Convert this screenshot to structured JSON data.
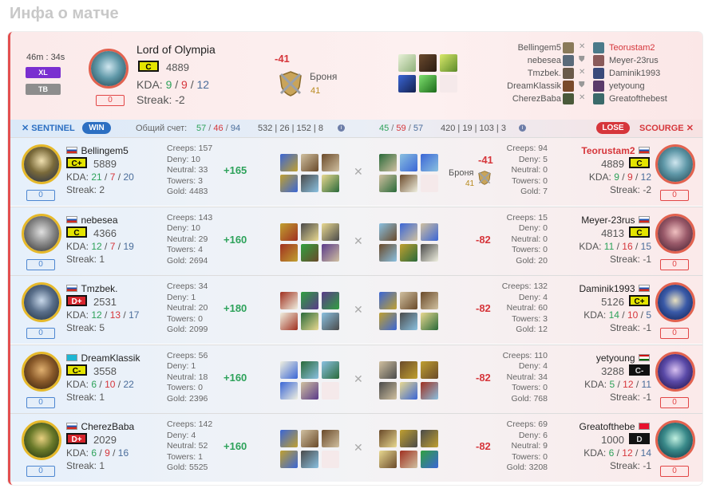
{
  "page_title": "Инфа о матче",
  "header": {
    "duration": "46m : 34s",
    "tag_xl": "XL",
    "tag_tb": "TB",
    "player_name": "Lord of Olympia",
    "rank": "C",
    "mmr": "4889",
    "kda_label": "KDA:",
    "kda_k": "9",
    "kda_d": "9",
    "kda_a": "12",
    "streak": "Streak: -2",
    "badge": "0",
    "delta": "-41",
    "armor_label": "Броня",
    "armor_value": "41",
    "matchups": [
      {
        "left": "Bellingem5",
        "right": "Teorustam2",
        "right_highlight": true
      },
      {
        "left": "nebesea",
        "right": "Meyer-23rus"
      },
      {
        "left": "Tmzbek.",
        "right": "Daminik1993"
      },
      {
        "left": "DreamKlassik",
        "right": "yetyoung"
      },
      {
        "left": "CherezBaba",
        "right": "Greatofthebest"
      }
    ]
  },
  "score": {
    "sentinel": "SENTINEL",
    "win": "WIN",
    "total_label": "Общий счет:",
    "s_k": "57",
    "s_d": "46",
    "s_a": "94",
    "s_stats": "532 | 26 | 152 | 8",
    "sc_k": "45",
    "sc_d": "59",
    "sc_a": "57",
    "sc_stats": "420 | 19 | 103 | 3",
    "lose": "LOSE",
    "scourge": "SCOURGE"
  },
  "rows": [
    {
      "l": {
        "name": "Bellingem5",
        "flag": "ru",
        "rank": "C+",
        "rank_style": "yellow",
        "mmr": "5889",
        "k": "21",
        "d": "7",
        "a": "20",
        "streak": "Streak: 2",
        "badge": "0",
        "creeps": "Creeps: 157",
        "deny": "Deny: 10",
        "neutral": "Neutral: 33",
        "towers": "Towers: 3",
        "gold": "Gold: 4483",
        "delta": "+165"
      },
      "r": {
        "name": "Teorustam2",
        "flag": "ru",
        "rank": "C",
        "rank_style": "yellow",
        "mmr": "4889",
        "k": "9",
        "d": "9",
        "a": "12",
        "streak": "Streak: -2",
        "badge": "0",
        "creeps": "Creeps: 94",
        "deny": "Deny: 5",
        "neutral": "Neutral: 0",
        "towers": "Towers: 0",
        "gold": "Gold: 7",
        "delta": "-41",
        "armor_label": "Броня",
        "armor_value": "41"
      }
    },
    {
      "l": {
        "name": "nebesea",
        "flag": "ru",
        "rank": "C",
        "rank_style": "yellow",
        "mmr": "4366",
        "k": "12",
        "d": "7",
        "a": "19",
        "streak": "Streak: 1",
        "badge": "0",
        "creeps": "Creeps: 143",
        "deny": "Deny: 10",
        "neutral": "Neutral: 29",
        "towers": "Towers: 4",
        "gold": "Gold: 2694",
        "delta": "+160"
      },
      "r": {
        "name": "Meyer-23rus",
        "flag": "ru",
        "rank": "C",
        "rank_style": "yellow",
        "mmr": "4813",
        "k": "11",
        "d": "16",
        "a": "15",
        "streak": "Streak: -1",
        "badge": "0",
        "creeps": "Creeps: 15",
        "deny": "Deny: 0",
        "neutral": "Neutral: 0",
        "towers": "Towers: 0",
        "gold": "Gold: 20",
        "delta": "-82"
      }
    },
    {
      "l": {
        "name": "Tmzbek.",
        "flag": "ru",
        "rank": "D+",
        "rank_style": "red",
        "mmr": "2531",
        "k": "12",
        "d": "13",
        "a": "17",
        "streak": "Streak: 5",
        "badge": "0",
        "creeps": "Creeps: 34",
        "deny": "Deny: 1",
        "neutral": "Neutral: 20",
        "towers": "Towers: 0",
        "gold": "Gold: 2099",
        "delta": "+180"
      },
      "r": {
        "name": "Daminik1993",
        "flag": "ru",
        "rank": "C+",
        "rank_style": "yellow",
        "mmr": "5126",
        "k": "14",
        "d": "10",
        "a": "5",
        "streak": "Streak: -1",
        "badge": "0",
        "creeps": "Creeps: 132",
        "deny": "Deny: 4",
        "neutral": "Neutral: 60",
        "towers": "Towers: 3",
        "gold": "Gold: 12",
        "delta": "-82"
      }
    },
    {
      "l": {
        "name": "DreamKlassik",
        "flag": "kz",
        "rank": "C-",
        "rank_style": "yellow",
        "mmr": "3558",
        "k": "6",
        "d": "10",
        "a": "22",
        "streak": "Streak: 1",
        "badge": "0",
        "creeps": "Creeps: 56",
        "deny": "Deny: 1",
        "neutral": "Neutral: 18",
        "towers": "Towers: 0",
        "gold": "Gold: 2396",
        "delta": "+160"
      },
      "r": {
        "name": "yetyoung",
        "flag": "tj",
        "rank": "C-",
        "rank_style": "black",
        "mmr": "3288",
        "k": "5",
        "d": "12",
        "a": "11",
        "streak": "Streak: -1",
        "badge": "0",
        "creeps": "Creeps: 110",
        "deny": "Deny: 4",
        "neutral": "Neutral: 34",
        "towers": "Towers: 0",
        "gold": "Gold: 768",
        "delta": "-82"
      }
    },
    {
      "l": {
        "name": "CherezBaba",
        "flag": "ru",
        "rank": "D+",
        "rank_style": "red",
        "mmr": "2029",
        "k": "6",
        "d": "9",
        "a": "16",
        "streak": "Streak: 1",
        "badge": "0",
        "creeps": "Creeps: 142",
        "deny": "Deny: 4",
        "neutral": "Neutral: 52",
        "towers": "Towers: 1",
        "gold": "Gold: 5525",
        "delta": "+160"
      },
      "r": {
        "name": "Greatofthebe",
        "flag": "kg",
        "rank": "D",
        "rank_style": "black",
        "mmr": "1000",
        "k": "6",
        "d": "12",
        "a": "14",
        "streak": "Streak: -1",
        "badge": "0",
        "creeps": "Creeps: 69",
        "deny": "Deny: 6",
        "neutral": "Neutral: 9",
        "towers": "Towers: 0",
        "gold": "Gold: 3208",
        "delta": "-82"
      }
    }
  ],
  "colors": {
    "win": "#2da25a",
    "lose": "#d6363b",
    "accent_blue": "#2c6fc2"
  }
}
